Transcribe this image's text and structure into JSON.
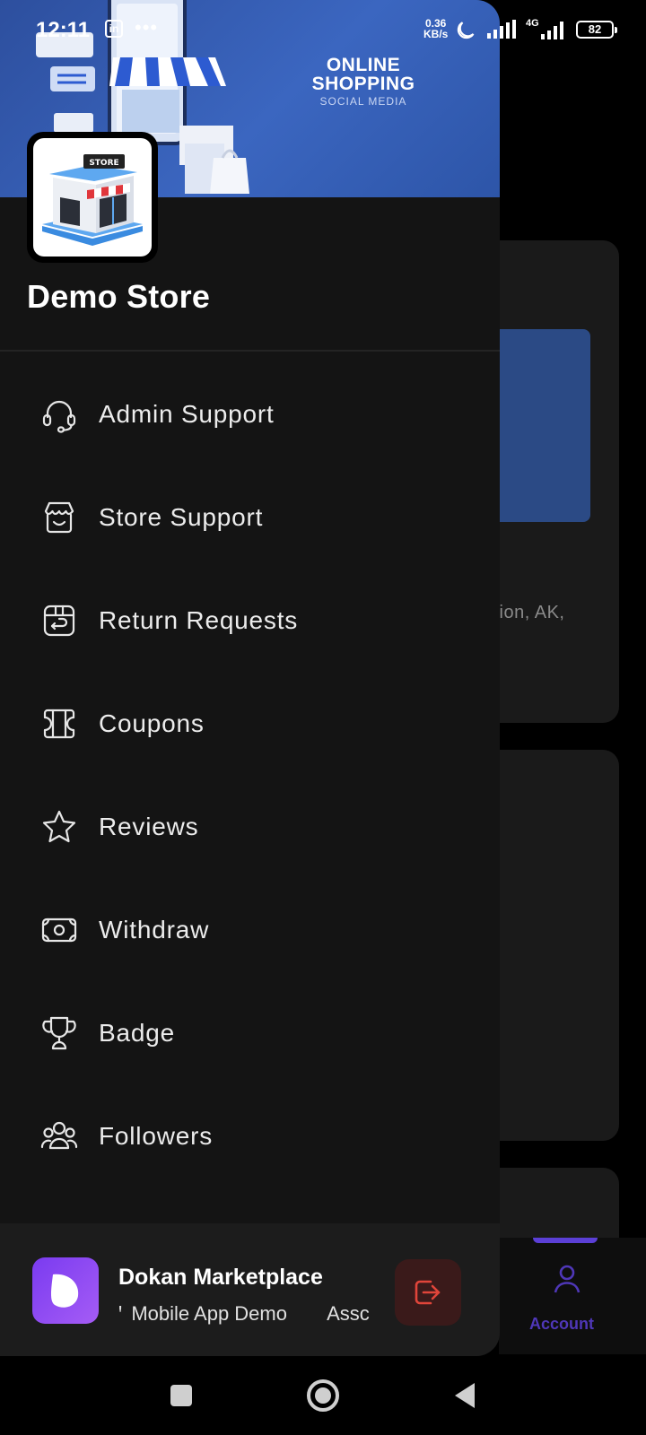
{
  "status_bar": {
    "time": "12:11",
    "notification_icon": "linkedin-icon",
    "more_dots": "•••",
    "net_speed_value": "0.36",
    "net_speed_unit": "KB/s",
    "network": "4G",
    "battery": "82"
  },
  "drawer": {
    "banner": {
      "headline": "ONLINE\nSHOPPING",
      "subline": "SOCIAL MEDIA"
    },
    "store_logo_text": "STORE",
    "store_name": "Demo Store",
    "menu": [
      {
        "label": "Admin Support",
        "icon": "headset-icon"
      },
      {
        "label": "Store Support",
        "icon": "store-support-icon"
      },
      {
        "label": "Return Requests",
        "icon": "return-icon"
      },
      {
        "label": "Coupons",
        "icon": "coupon-icon"
      },
      {
        "label": "Reviews",
        "icon": "star-icon"
      },
      {
        "label": "Withdraw",
        "icon": "money-icon"
      },
      {
        "label": "Badge",
        "icon": "trophy-icon"
      },
      {
        "label": "Followers",
        "icon": "followers-icon"
      }
    ],
    "footer": {
      "app_name": "Dokan Marketplace",
      "app_subtitle": "Mobile App Demo",
      "app_subtitle_prefix": "ꞌ",
      "app_subtitle_cut": "Assc",
      "logout_icon": "logout-icon"
    }
  },
  "background": {
    "card_text": "ction, AK,",
    "bottom_nav_label": "Account",
    "accent_color": "#5b3fd6"
  },
  "colors": {
    "drawer_bg": "#141414",
    "banner_blue": "#3b66c0",
    "logout_red": "#e0453a",
    "app_purple": "#8b45f2"
  }
}
